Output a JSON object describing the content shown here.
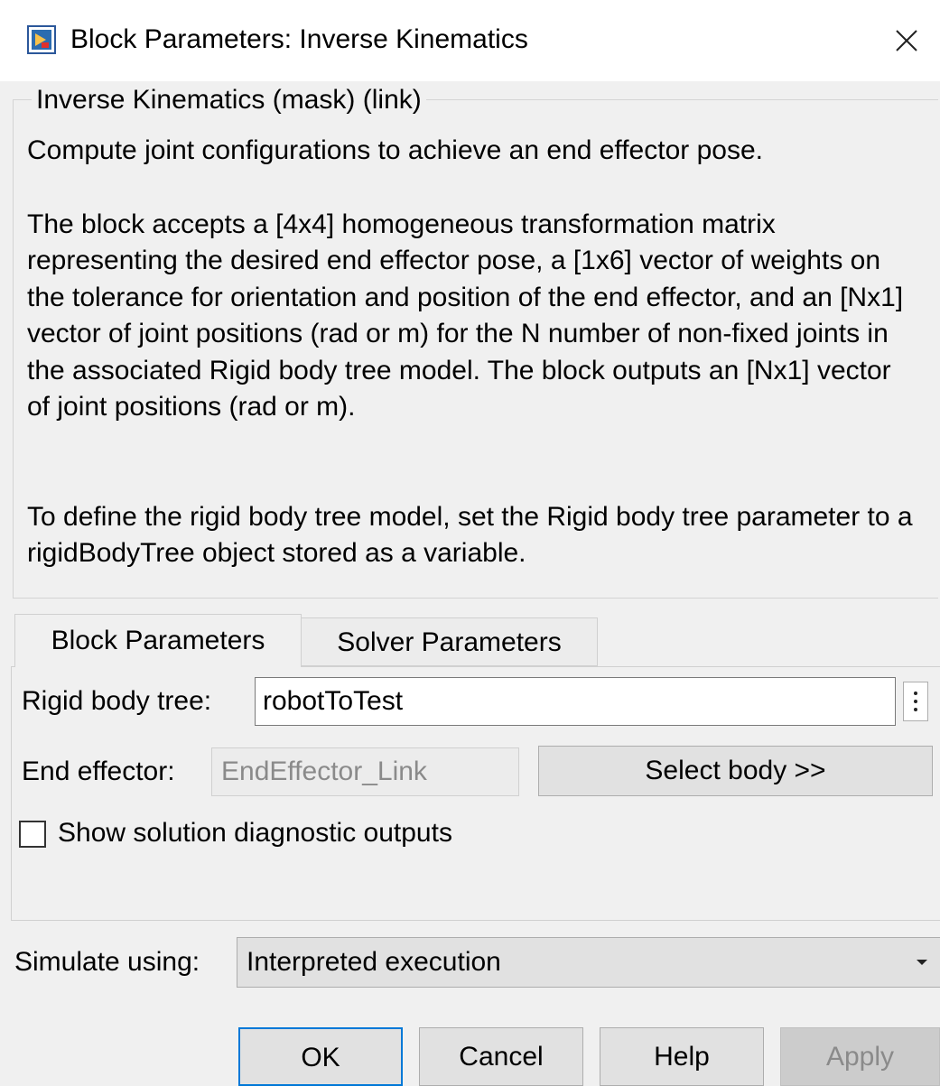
{
  "window": {
    "title": "Block Parameters: Inverse Kinematics"
  },
  "description": {
    "heading": "Inverse Kinematics (mask) (link)",
    "paragraph1": "Compute joint configurations to achieve an end effector pose.",
    "paragraph2": "The block accepts a [4x4] homogeneous transformation matrix representing the desired end effector pose, a [1x6] vector of weights on the tolerance for orientation and position of the end effector, and an [Nx1] vector of joint positions (rad or m) for the N number of non-fixed joints in the associated Rigid body tree model. The block outputs an [Nx1] vector of joint positions (rad or m).",
    "paragraph3": "To define the rigid body tree model, set the Rigid body tree parameter to a rigidBodyTree object stored as a variable."
  },
  "tabs": [
    {
      "label": "Block Parameters",
      "active": true
    },
    {
      "label": "Solver Parameters",
      "active": false
    }
  ],
  "params": {
    "rigid_body_tree_label": "Rigid body tree:",
    "rigid_body_tree_value": "robotToTest",
    "end_effector_label": "End effector:",
    "end_effector_value": "EndEffector_Link",
    "select_body_label": "Select body >>",
    "show_diagnostics_label": "Show solution diagnostic outputs",
    "show_diagnostics_checked": false
  },
  "simulate": {
    "label": "Simulate using:",
    "value": "Interpreted execution"
  },
  "buttons": {
    "ok": "OK",
    "cancel": "Cancel",
    "help": "Help",
    "apply": "Apply"
  },
  "colors": {
    "window_bg": "#f0f0f0",
    "titlebar_bg": "#ffffff",
    "button_bg": "#e1e1e1",
    "default_button_border": "#0078d7",
    "disabled_text": "#8a8a8a"
  },
  "icons": {
    "title": "simulink-block-icon",
    "close": "close-icon",
    "menu": "vertical-ellipsis-icon",
    "dropdown": "dropdown-arrow-icon"
  }
}
